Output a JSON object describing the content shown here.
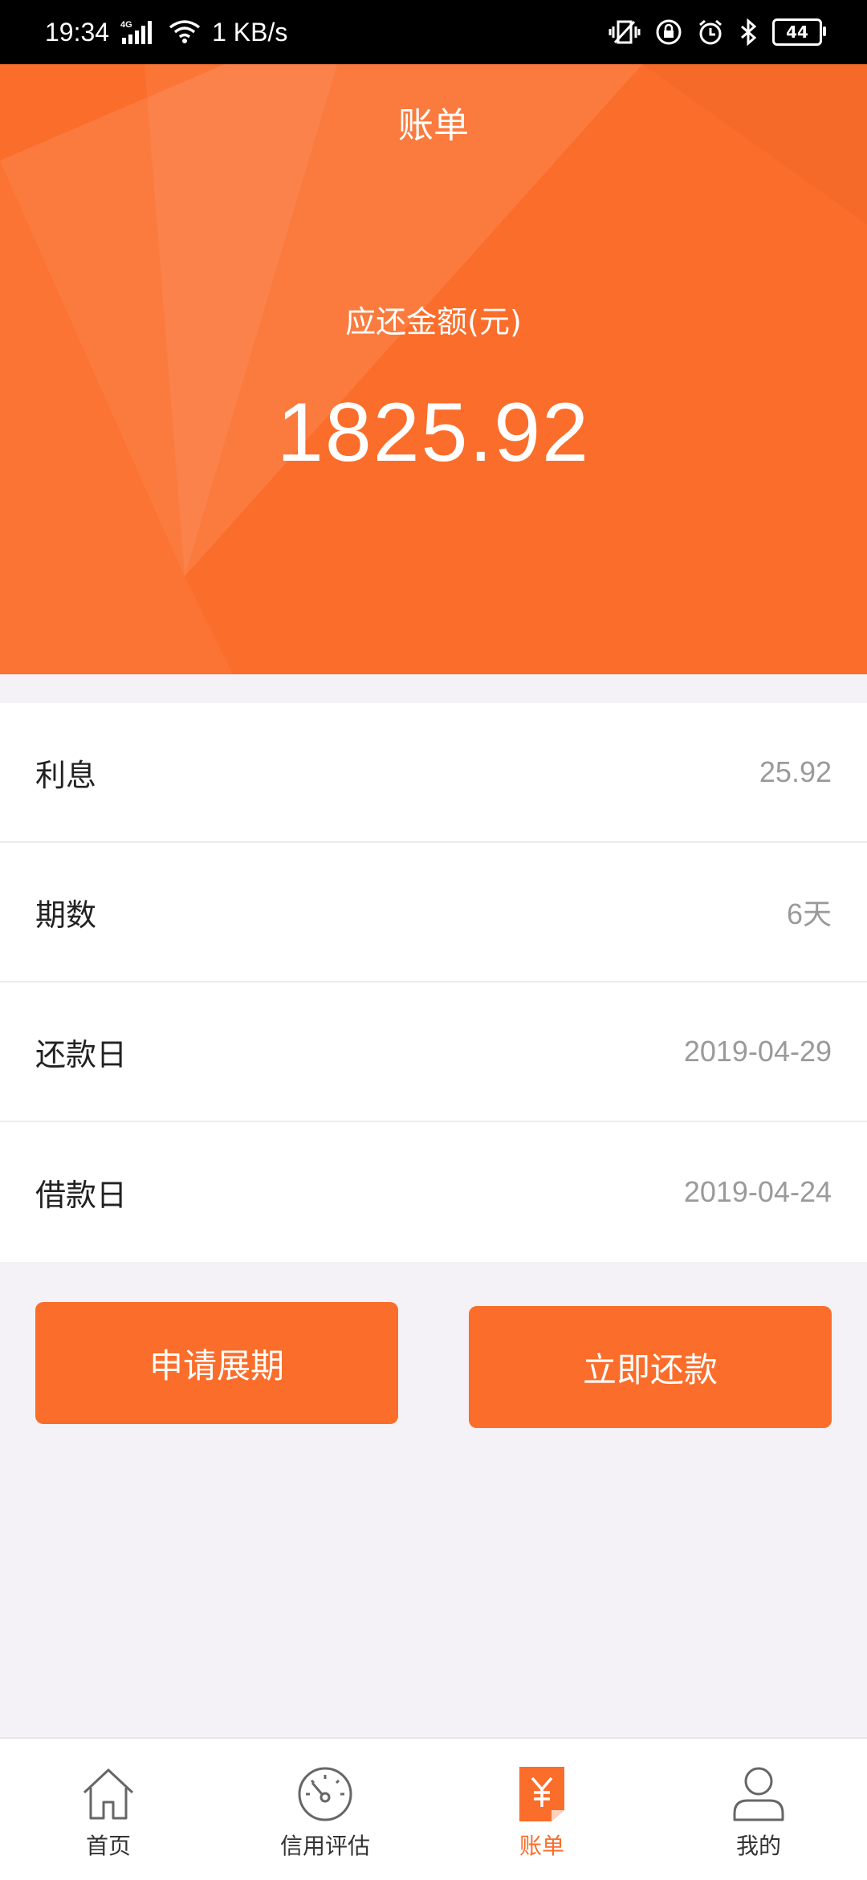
{
  "status_bar": {
    "time": "19:34",
    "network": "4G",
    "speed": "1 KB/s",
    "battery": "44"
  },
  "header": {
    "title": "账单",
    "amount_label": "应还金额(元)",
    "amount": "1825.92"
  },
  "details": [
    {
      "label": "利息",
      "value": "25.92"
    },
    {
      "label": "期数",
      "value": "6天"
    },
    {
      "label": "还款日",
      "value": "2019-04-29"
    },
    {
      "label": "借款日",
      "value": "2019-04-24"
    }
  ],
  "actions": {
    "extend_label": "申请展期",
    "repay_label": "立即还款"
  },
  "nav": [
    {
      "label": "首页",
      "icon": "home-icon"
    },
    {
      "label": "信用评估",
      "icon": "gauge-icon"
    },
    {
      "label": "账单",
      "icon": "bill-icon",
      "active": true
    },
    {
      "label": "我的",
      "icon": "user-icon"
    }
  ],
  "colors": {
    "accent": "#fb6d2a",
    "background": "#f4f2f7"
  }
}
